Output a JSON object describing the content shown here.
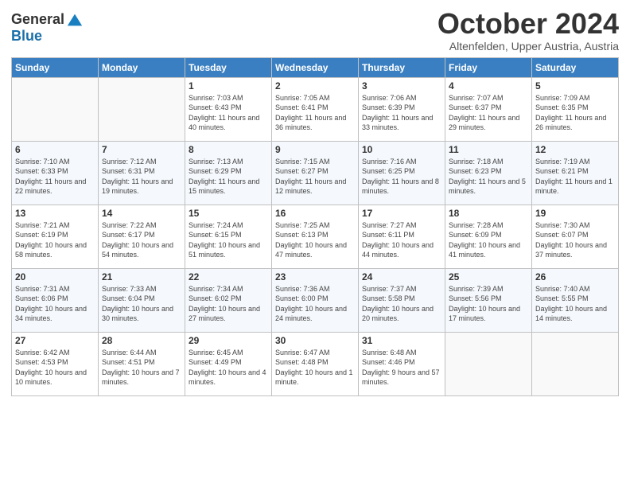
{
  "logo": {
    "line1": "General",
    "line2": "Blue"
  },
  "header": {
    "month": "October 2024",
    "location": "Altenfelden, Upper Austria, Austria"
  },
  "weekdays": [
    "Sunday",
    "Monday",
    "Tuesday",
    "Wednesday",
    "Thursday",
    "Friday",
    "Saturday"
  ],
  "weeks": [
    [
      {
        "day": "",
        "info": ""
      },
      {
        "day": "",
        "info": ""
      },
      {
        "day": "1",
        "info": "Sunrise: 7:03 AM\nSunset: 6:43 PM\nDaylight: 11 hours and 40 minutes."
      },
      {
        "day": "2",
        "info": "Sunrise: 7:05 AM\nSunset: 6:41 PM\nDaylight: 11 hours and 36 minutes."
      },
      {
        "day": "3",
        "info": "Sunrise: 7:06 AM\nSunset: 6:39 PM\nDaylight: 11 hours and 33 minutes."
      },
      {
        "day": "4",
        "info": "Sunrise: 7:07 AM\nSunset: 6:37 PM\nDaylight: 11 hours and 29 minutes."
      },
      {
        "day": "5",
        "info": "Sunrise: 7:09 AM\nSunset: 6:35 PM\nDaylight: 11 hours and 26 minutes."
      }
    ],
    [
      {
        "day": "6",
        "info": "Sunrise: 7:10 AM\nSunset: 6:33 PM\nDaylight: 11 hours and 22 minutes."
      },
      {
        "day": "7",
        "info": "Sunrise: 7:12 AM\nSunset: 6:31 PM\nDaylight: 11 hours and 19 minutes."
      },
      {
        "day": "8",
        "info": "Sunrise: 7:13 AM\nSunset: 6:29 PM\nDaylight: 11 hours and 15 minutes."
      },
      {
        "day": "9",
        "info": "Sunrise: 7:15 AM\nSunset: 6:27 PM\nDaylight: 11 hours and 12 minutes."
      },
      {
        "day": "10",
        "info": "Sunrise: 7:16 AM\nSunset: 6:25 PM\nDaylight: 11 hours and 8 minutes."
      },
      {
        "day": "11",
        "info": "Sunrise: 7:18 AM\nSunset: 6:23 PM\nDaylight: 11 hours and 5 minutes."
      },
      {
        "day": "12",
        "info": "Sunrise: 7:19 AM\nSunset: 6:21 PM\nDaylight: 11 hours and 1 minute."
      }
    ],
    [
      {
        "day": "13",
        "info": "Sunrise: 7:21 AM\nSunset: 6:19 PM\nDaylight: 10 hours and 58 minutes."
      },
      {
        "day": "14",
        "info": "Sunrise: 7:22 AM\nSunset: 6:17 PM\nDaylight: 10 hours and 54 minutes."
      },
      {
        "day": "15",
        "info": "Sunrise: 7:24 AM\nSunset: 6:15 PM\nDaylight: 10 hours and 51 minutes."
      },
      {
        "day": "16",
        "info": "Sunrise: 7:25 AM\nSunset: 6:13 PM\nDaylight: 10 hours and 47 minutes."
      },
      {
        "day": "17",
        "info": "Sunrise: 7:27 AM\nSunset: 6:11 PM\nDaylight: 10 hours and 44 minutes."
      },
      {
        "day": "18",
        "info": "Sunrise: 7:28 AM\nSunset: 6:09 PM\nDaylight: 10 hours and 41 minutes."
      },
      {
        "day": "19",
        "info": "Sunrise: 7:30 AM\nSunset: 6:07 PM\nDaylight: 10 hours and 37 minutes."
      }
    ],
    [
      {
        "day": "20",
        "info": "Sunrise: 7:31 AM\nSunset: 6:06 PM\nDaylight: 10 hours and 34 minutes."
      },
      {
        "day": "21",
        "info": "Sunrise: 7:33 AM\nSunset: 6:04 PM\nDaylight: 10 hours and 30 minutes."
      },
      {
        "day": "22",
        "info": "Sunrise: 7:34 AM\nSunset: 6:02 PM\nDaylight: 10 hours and 27 minutes."
      },
      {
        "day": "23",
        "info": "Sunrise: 7:36 AM\nSunset: 6:00 PM\nDaylight: 10 hours and 24 minutes."
      },
      {
        "day": "24",
        "info": "Sunrise: 7:37 AM\nSunset: 5:58 PM\nDaylight: 10 hours and 20 minutes."
      },
      {
        "day": "25",
        "info": "Sunrise: 7:39 AM\nSunset: 5:56 PM\nDaylight: 10 hours and 17 minutes."
      },
      {
        "day": "26",
        "info": "Sunrise: 7:40 AM\nSunset: 5:55 PM\nDaylight: 10 hours and 14 minutes."
      }
    ],
    [
      {
        "day": "27",
        "info": "Sunrise: 6:42 AM\nSunset: 4:53 PM\nDaylight: 10 hours and 10 minutes."
      },
      {
        "day": "28",
        "info": "Sunrise: 6:44 AM\nSunset: 4:51 PM\nDaylight: 10 hours and 7 minutes."
      },
      {
        "day": "29",
        "info": "Sunrise: 6:45 AM\nSunset: 4:49 PM\nDaylight: 10 hours and 4 minutes."
      },
      {
        "day": "30",
        "info": "Sunrise: 6:47 AM\nSunset: 4:48 PM\nDaylight: 10 hours and 1 minute."
      },
      {
        "day": "31",
        "info": "Sunrise: 6:48 AM\nSunset: 4:46 PM\nDaylight: 9 hours and 57 minutes."
      },
      {
        "day": "",
        "info": ""
      },
      {
        "day": "",
        "info": ""
      }
    ]
  ]
}
